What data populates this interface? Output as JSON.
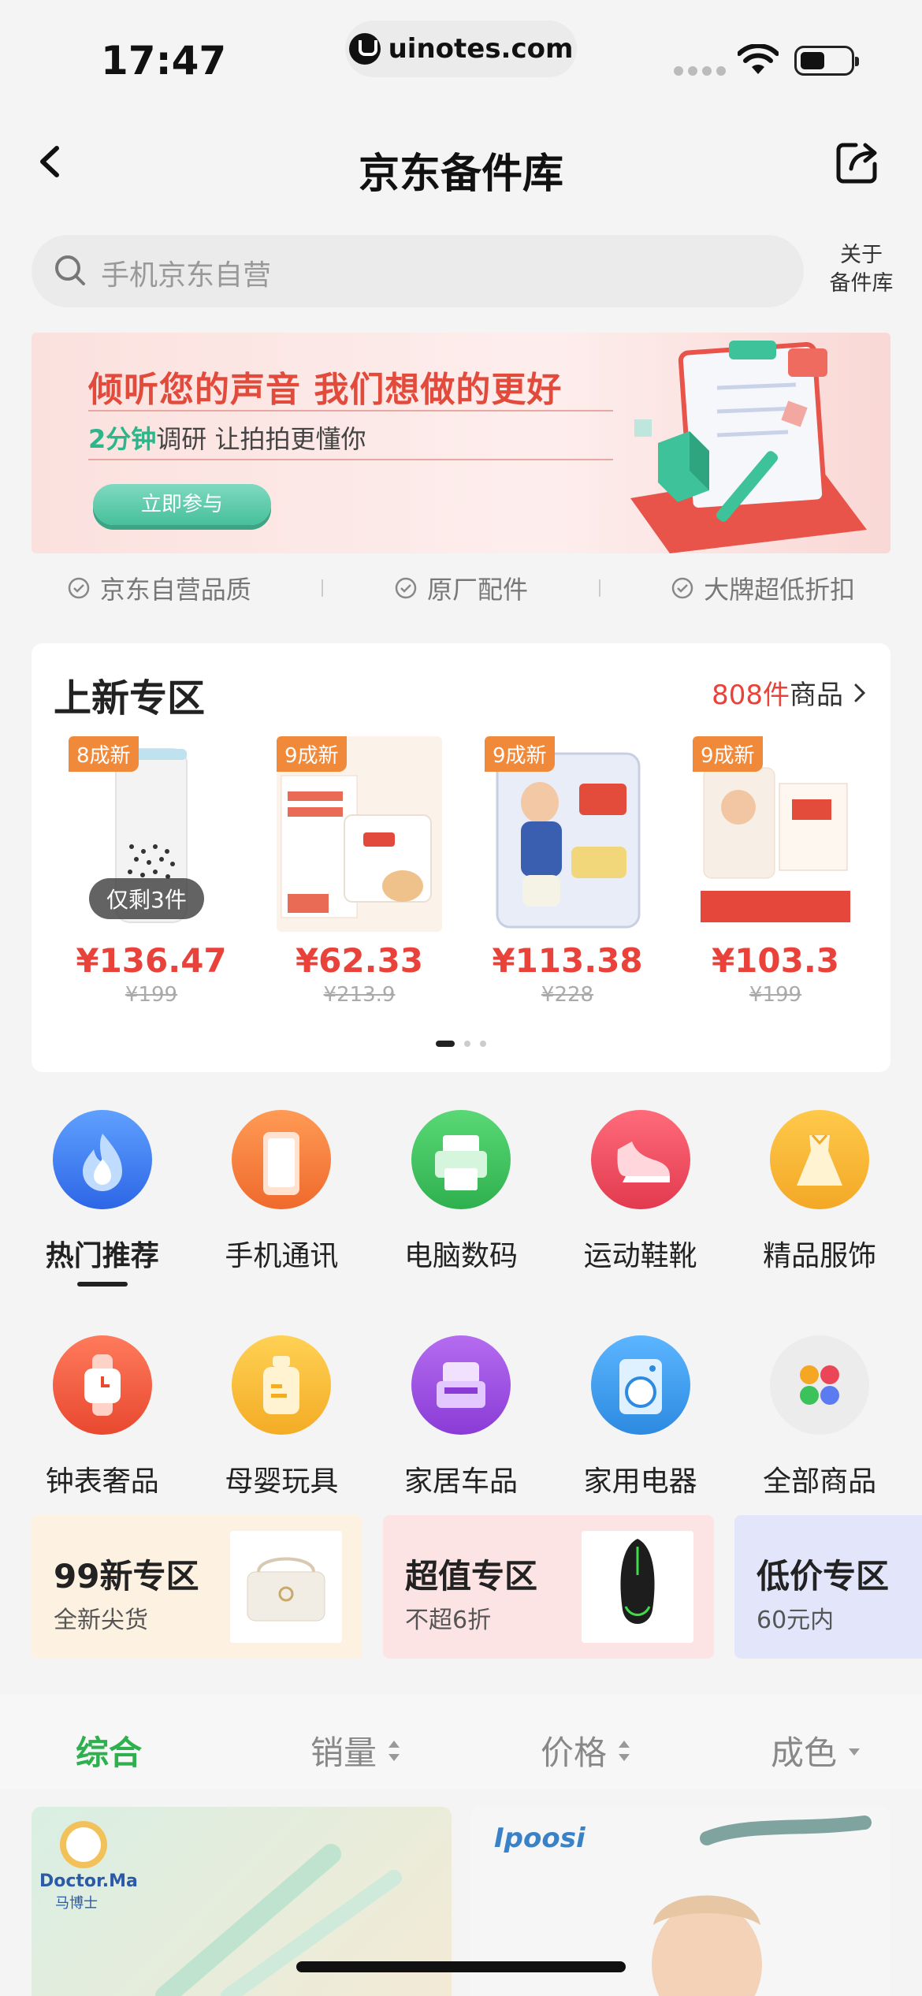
{
  "status": {
    "time": "17:47",
    "url": "uinotes.com"
  },
  "nav": {
    "title": "京东备件库"
  },
  "search": {
    "placeholder": "手机京东自营",
    "about_line1": "关于",
    "about_line2": "备件库"
  },
  "banner": {
    "title": "倾听您的声音 我们想做的更好",
    "sub_highlight": "2分钟",
    "sub_text": "调研 让拍拍更懂你",
    "button": "立即参与"
  },
  "quality": [
    "京东自营品质",
    "原厂配件",
    "大牌超低折扣"
  ],
  "new_section": {
    "title": "上新专区",
    "count_num": "808件",
    "count_text": "商品",
    "products": [
      {
        "badge": "8成新",
        "price": "¥136.47",
        "orig": "¥199",
        "stock": "仅剩3件"
      },
      {
        "badge": "9成新",
        "price": "¥62.33",
        "orig": "¥213.9"
      },
      {
        "badge": "9成新",
        "price": "¥113.38",
        "orig": "¥228"
      },
      {
        "badge": "9成新",
        "price": "¥103.3",
        "orig": "¥199"
      }
    ]
  },
  "categories": [
    {
      "label": "热门推荐",
      "icon": "flame-icon",
      "color": "#3a7bf2"
    },
    {
      "label": "手机通讯",
      "icon": "phone-icon",
      "color": "#f07a3a"
    },
    {
      "label": "电脑数码",
      "icon": "printer-icon",
      "color": "#3cc25a"
    },
    {
      "label": "运动鞋靴",
      "icon": "shoe-icon",
      "color": "#ea4658"
    },
    {
      "label": "精品服饰",
      "icon": "dress-icon",
      "color": "#f6b52d"
    },
    {
      "label": "钟表奢品",
      "icon": "watch-icon",
      "color": "#ef5a43"
    },
    {
      "label": "母婴玩具",
      "icon": "bottle-icon",
      "color": "#f6b72f"
    },
    {
      "label": "家居车品",
      "icon": "sofa-icon",
      "color": "#9b4be0"
    },
    {
      "label": "家用电器",
      "icon": "washer-icon",
      "color": "#3a9be8"
    },
    {
      "label": "全部商品",
      "icon": "grid-icon",
      "color": "#eeeeee"
    }
  ],
  "zones": [
    {
      "title": "99新专区",
      "sub": "全新尖货",
      "bg": "#fdf1e2"
    },
    {
      "title": "超值专区",
      "sub": "不超6折",
      "bg": "#fbe4e3"
    },
    {
      "title": "低价专区",
      "sub": "60元内",
      "bg": "#e3e6fb"
    }
  ],
  "sort": {
    "s1": "综合",
    "s2": "销量",
    "s3": "价格",
    "s4": "成色"
  },
  "listing": {
    "brand1": "Doctor.Ma",
    "brand1_cn": "马博士",
    "brand2": "Ipoosi"
  }
}
